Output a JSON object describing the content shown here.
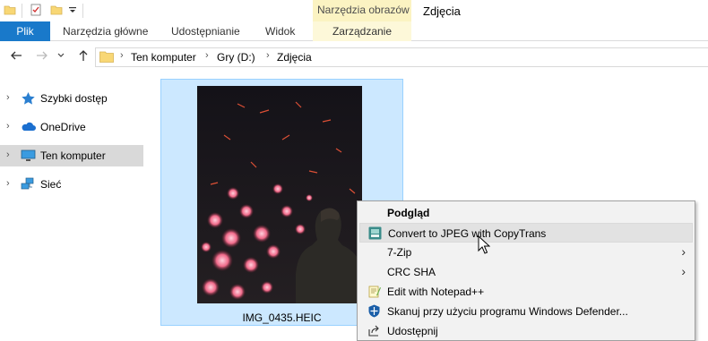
{
  "titlebar": {
    "quick_access_icons": [
      "folder-icon",
      "properties-icon",
      "new-folder-icon",
      "customize-quick-access-icon"
    ],
    "context_tab_header": "Narzędzia obrazów",
    "window_title": "Zdjęcia"
  },
  "ribbon": {
    "tabs": [
      "Plik",
      "Narzędzia główne",
      "Udostępnianie",
      "Widok",
      "Zarządzanie"
    ],
    "colors": {
      "file_tab": "#1979ca",
      "context_tab": "#fbf3c2"
    }
  },
  "address": {
    "crumbs": [
      "Ten komputer",
      "Gry (D:)",
      "Zdjęcia"
    ]
  },
  "nav_pane": {
    "items": [
      {
        "label": "Szybki dostęp",
        "icon": "star-icon"
      },
      {
        "label": "OneDrive",
        "icon": "cloud-icon"
      },
      {
        "label": "Ten komputer",
        "icon": "computer-icon",
        "selected": true
      },
      {
        "label": "Sieć",
        "icon": "network-icon"
      }
    ]
  },
  "content": {
    "file": {
      "name": "IMG_0435.HEIC",
      "selected": true
    }
  },
  "context_menu": {
    "items": [
      {
        "label": "Podgląd",
        "bold": true
      },
      {
        "label": "Convert to JPEG with CopyTrans",
        "icon": "copytrans-icon",
        "hover": true
      },
      {
        "label": "7-Zip",
        "submenu": true
      },
      {
        "label": "CRC SHA",
        "submenu": true
      },
      {
        "label": "Edit with Notepad++",
        "icon": "notepadpp-icon"
      },
      {
        "label": "Skanuj przy użyciu programu Windows Defender...",
        "icon": "defender-icon"
      },
      {
        "label": "Udostępnij",
        "icon": "share-icon"
      }
    ]
  }
}
